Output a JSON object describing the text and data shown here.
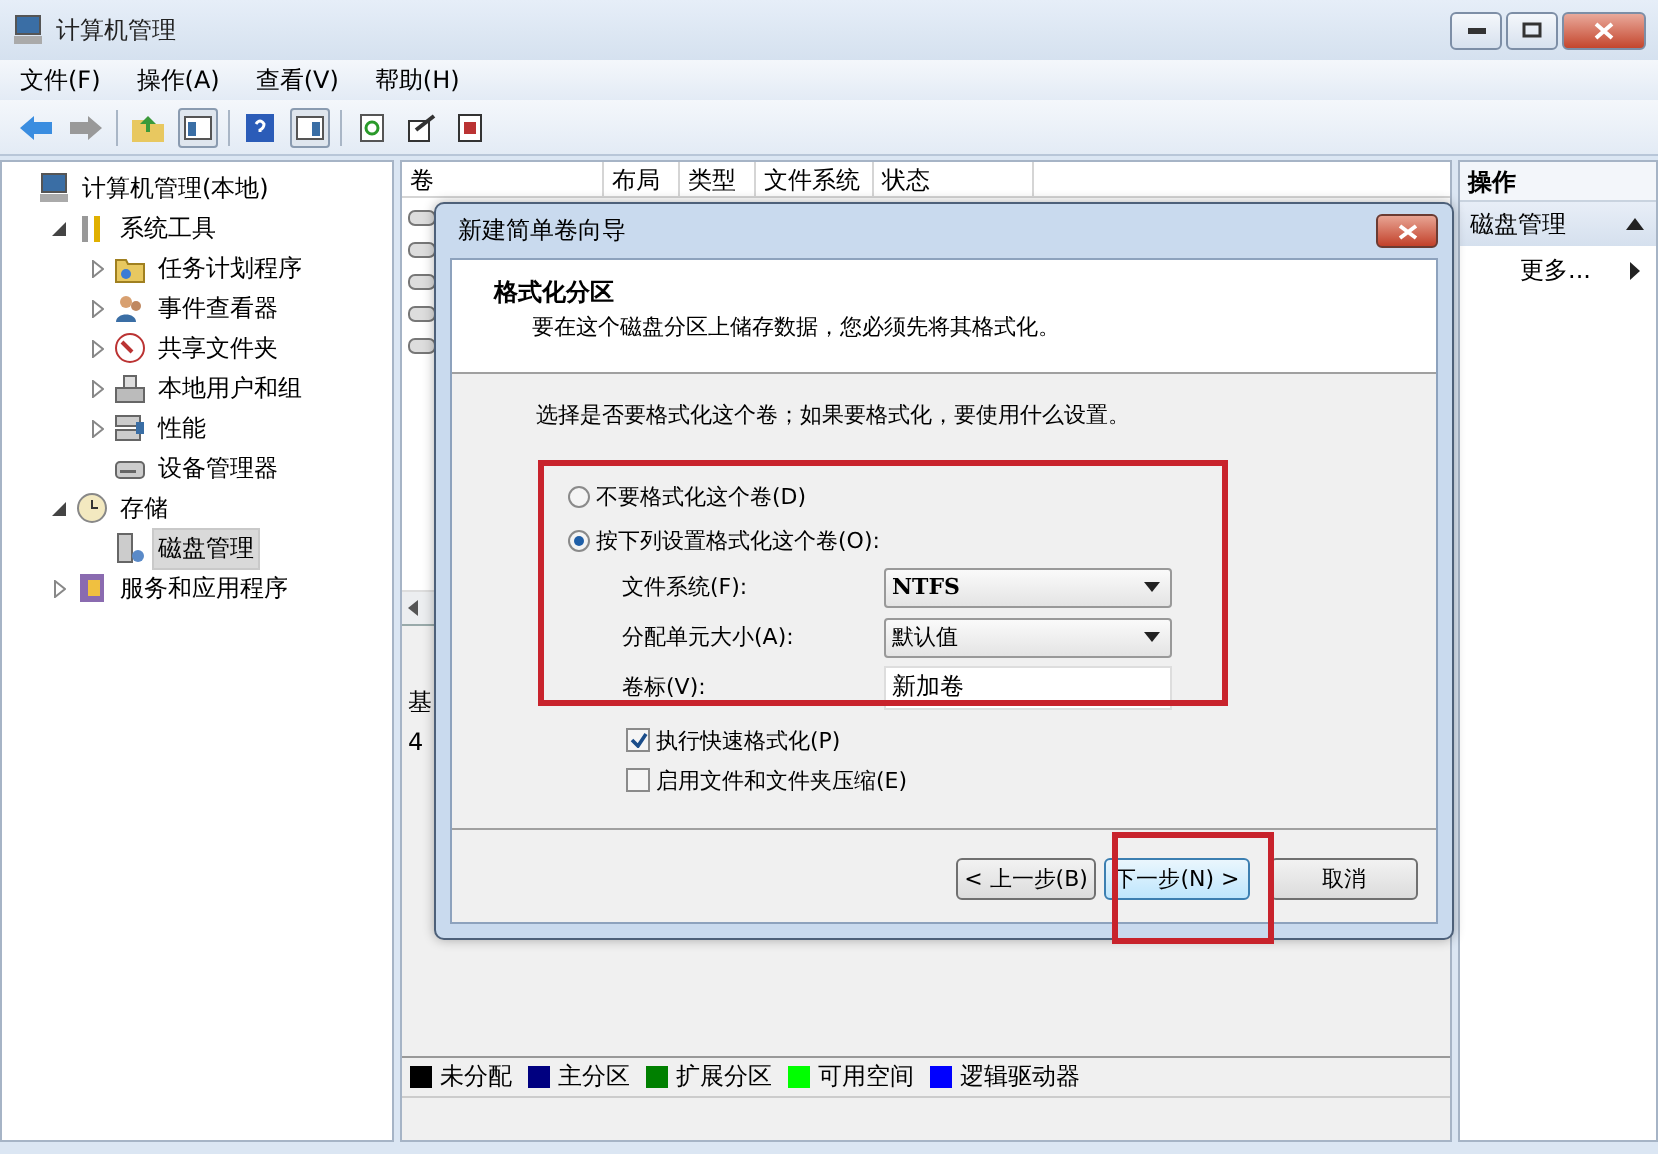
{
  "window": {
    "title": "计算机管理"
  },
  "menu": [
    {
      "label": "文件(F)"
    },
    {
      "label": "操作(A)"
    },
    {
      "label": "查看(V)"
    },
    {
      "label": "帮助(H)"
    }
  ],
  "tree": [
    {
      "label": "计算机管理(本地)",
      "selected": false,
      "children": [
        {
          "label": "系统工具",
          "expanded": true,
          "selected": false,
          "children": [
            {
              "label": "任务计划程序",
              "expanded": false,
              "selected": false
            },
            {
              "label": "事件查看器",
              "expanded": false,
              "selected": false
            },
            {
              "label": "共享文件夹",
              "expanded": false,
              "selected": false
            },
            {
              "label": "本地用户和组",
              "expanded": false,
              "selected": false
            },
            {
              "label": "性能",
              "expanded": false,
              "selected": false
            },
            {
              "label": "设备管理器",
              "selected": false
            }
          ]
        },
        {
          "label": "存储",
          "expanded": true,
          "selected": false,
          "children": [
            {
              "label": "磁盘管理",
              "selected": true
            }
          ]
        },
        {
          "label": "服务和应用程序",
          "expanded": false,
          "selected": false
        }
      ]
    }
  ],
  "volume_table": {
    "columns": [
      "卷",
      "布局",
      "类型",
      "文件系统",
      "状态"
    ]
  },
  "disk_pane": {
    "partial_texts": [
      "基",
      "4"
    ]
  },
  "legend": [
    {
      "label": "未分配",
      "color": "#000000"
    },
    {
      "label": "主分区",
      "color": "#000080"
    },
    {
      "label": "扩展分区",
      "color": "#008000"
    },
    {
      "label": "可用空间",
      "color": "#00ff00"
    },
    {
      "label": "逻辑驱动器",
      "color": "#0000ff"
    }
  ],
  "actions": {
    "title": "操作",
    "section": "磁盘管理",
    "items": [
      "更多..."
    ]
  },
  "dialog": {
    "title": "新建简单卷向导",
    "heading": "格式化分区",
    "subtitle": "要在这个磁盘分区上储存数据，您必须先将其格式化。",
    "prompt": "选择是否要格式化这个卷；如果要格式化，要使用什么设置。",
    "options": [
      {
        "label": "不要格式化这个卷(D)",
        "selected": false
      },
      {
        "label": "按下列设置格式化这个卷(O):",
        "selected": true
      }
    ],
    "fields": [
      {
        "kind": "select",
        "label": "文件系统(F):",
        "value": "NTFS"
      },
      {
        "kind": "select",
        "label": "分配单元大小(A):",
        "value": "默认值"
      },
      {
        "kind": "text",
        "label": "卷标(V):",
        "value": "新加卷"
      }
    ],
    "checkboxes": [
      {
        "label": "执行快速格式化(P)",
        "checked": true
      },
      {
        "label": "启用文件和文件夹压缩(E)",
        "checked": false
      }
    ],
    "buttons": [
      {
        "label": "< 上一步(B)",
        "focused": false
      },
      {
        "label": "下一步(N) >",
        "focused": true
      },
      {
        "label": "取消",
        "focused": false
      }
    ]
  }
}
